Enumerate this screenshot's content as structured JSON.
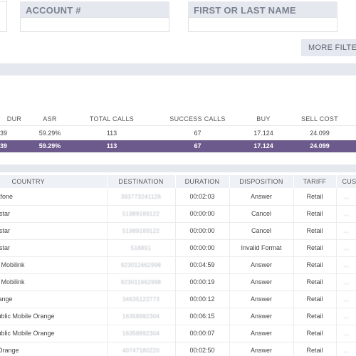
{
  "filters": {
    "account_label": "ACCOUNT #",
    "account_value": "",
    "name_label": "FIRST OR LAST NAME",
    "name_value": "",
    "more_filters_label": "MORE FILTER"
  },
  "summary": {
    "headers": [
      "DUR",
      "ASR",
      "TOTAL CALLS",
      "SUCCESS CALLS",
      "BUY",
      "SELL COST"
    ],
    "row": [
      "39",
      "59.29%",
      "113",
      "67",
      "17.124",
      "24.099"
    ],
    "total": [
      "39",
      "59.29%",
      "113",
      "67",
      "17.124",
      "24.099"
    ]
  },
  "calls": {
    "headers": [
      "COUNTRY",
      "DESTINATION",
      "DURATION",
      "DISPOSITION",
      "TARIFF",
      "CUS"
    ],
    "rows": [
      {
        "country": "Vodafone",
        "destination": "393773241126",
        "duration": "00:02:03",
        "disposition": "Answer",
        "tariff": "Retail",
        "cus": "..."
      },
      {
        "country": " Movistar",
        "destination": "51989189122",
        "duration": "00:00:00",
        "disposition": "Cancel",
        "tariff": "Retail",
        "cus": "..."
      },
      {
        "country": " Movistar",
        "destination": "51989189122",
        "duration": "00:00:00",
        "disposition": "Cancel",
        "tariff": "Retail",
        "cus": "..."
      },
      {
        "country": " Movistar",
        "destination": "518891",
        "duration": "00:00:00",
        "disposition": "Invalid Format",
        "tariff": "Retail",
        "cus": "..."
      },
      {
        "country": "obile Mobilink",
        "destination": "923011662998",
        "duration": "00:04:59",
        "disposition": "Answer",
        "tariff": "Retail",
        "cus": "..."
      },
      {
        "country": "obile Mobilink",
        "destination": "923011662998",
        "duration": "00:00:19",
        "disposition": "Answer",
        "tariff": "Retail",
        "cus": "..."
      },
      {
        "country": "e Orange",
        "destination": "34635122773",
        "duration": "00:00:12",
        "disposition": "Answer",
        "tariff": "Retail",
        "cus": "..."
      },
      {
        "country": "Republic Mobile Orange",
        "destination": "16358992304",
        "duration": "00:06:15",
        "disposition": "Answer",
        "tariff": "Retail",
        "cus": "..."
      },
      {
        "country": "Republic Mobile Orange",
        "destination": "16358992304",
        "duration": "00:00:07",
        "disposition": "Answer",
        "tariff": "Retail",
        "cus": "..."
      },
      {
        "country": "bile Orange",
        "destination": "40747180220",
        "duration": "00:02:50",
        "disposition": "Answer",
        "tariff": "Retail",
        "cus": "..."
      }
    ]
  }
}
